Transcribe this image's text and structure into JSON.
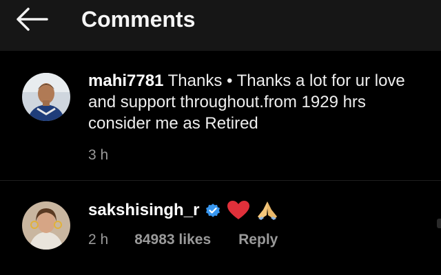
{
  "header": {
    "title": "Comments",
    "back_icon": "arrow-left-icon"
  },
  "comments": [
    {
      "username": "mahi7781",
      "text": "Thanks • Thanks a lot for ur love and support throughout.from 1929 hrs consider me as Retired",
      "time": "3 h",
      "avatar_icon": "user-avatar"
    },
    {
      "username": "sakshisingh_r",
      "verified": true,
      "emojis": [
        "heart-icon",
        "folded-hands-icon"
      ],
      "time": "2 h",
      "likes": "84983 likes",
      "reply_label": "Reply",
      "avatar_icon": "user-avatar"
    }
  ],
  "colors": {
    "background": "#000000",
    "header": "#161616",
    "text": "#eeeeee",
    "muted": "#9a9a9a",
    "verified": "#3897f0",
    "heart": "#e0303a"
  }
}
